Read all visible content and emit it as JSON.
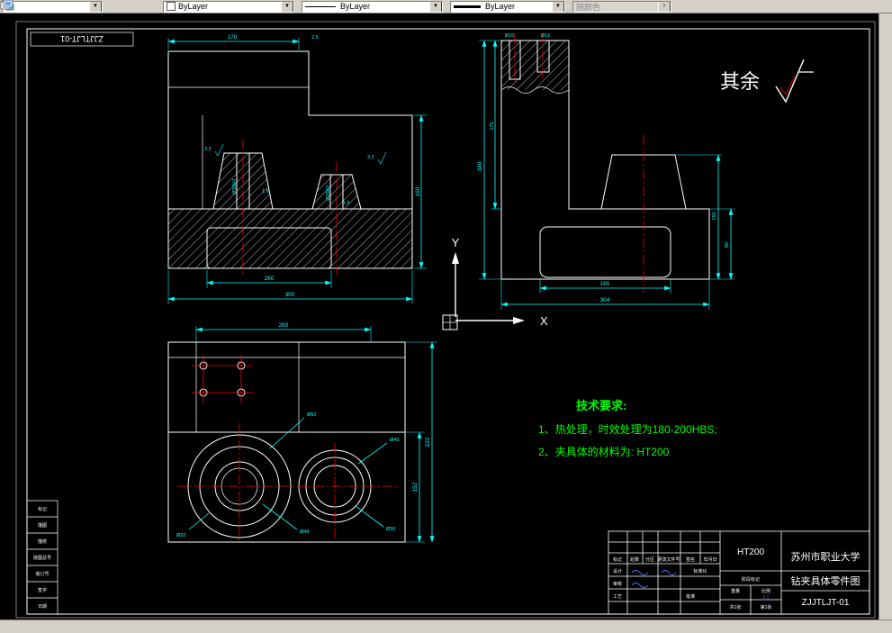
{
  "toolbar": {
    "color_value": "ByLayer",
    "linetype_value": "ByLayer",
    "lineweight_value": "ByLayer",
    "plotstyle_value": "随颜色"
  },
  "frame": {
    "stamp": "ZJJTLJT-01"
  },
  "notes": {
    "surface_label": "其余",
    "tech_title": "技术要求:",
    "tech_1": "1、热处理，时效处理为180-200HBS;",
    "tech_2": "2、夹具体的材料为: HT200"
  },
  "ucs": {
    "x_label": "X",
    "y_label": "Y"
  },
  "dims": {
    "fv_top": "170",
    "fv_top2": "2.5",
    "fv_right": "160",
    "fv_bot1": "260",
    "fv_bot2": "300",
    "fv_hole1": "Ø30H7",
    "fv_hole2": "Ø25H7",
    "sf1": "3.2",
    "sf2": "3.2",
    "sf3": "1.6",
    "sf4": "1.6",
    "sv_hole1": "Ø10",
    "sv_hole2": "Ø16",
    "sv_left1": "340",
    "sv_left2": "175",
    "sv_right1": "150",
    "sv_right2": "80",
    "sv_bot1": "165",
    "sv_bot2": "304",
    "tv_top": "260",
    "tv_right1": "152",
    "tv_right2": "222",
    "tv_c1": "Ø62",
    "tv_c2": "Ø48",
    "tv_c3": "Ø40",
    "tv_c4": "Ø30",
    "tv_c5": "Ø20"
  },
  "titleblock": {
    "material": "HT200",
    "school": "苏州市职业大学",
    "drawing_title": "钻夹具体零件图",
    "drawing_no": "ZJJTLJT-01",
    "labels": {
      "mark": "标记",
      "count": "处数",
      "zone": "分区",
      "doc_no": "更改文件号",
      "sign": "签名",
      "date": "年月日",
      "design": "设计",
      "standardize": "标准化",
      "check": "审核",
      "process": "工艺",
      "approve": "批准",
      "stage": "阶段标记",
      "weight": "重量",
      "scale": "比例",
      "sheet": "共1张",
      "page": "第1张"
    },
    "values": {
      "scale": "1:1"
    }
  },
  "leftstrip": {
    "rows": [
      "标记",
      "描图",
      "描校",
      "底图总号",
      "装订号",
      "签字",
      "日期"
    ]
  }
}
